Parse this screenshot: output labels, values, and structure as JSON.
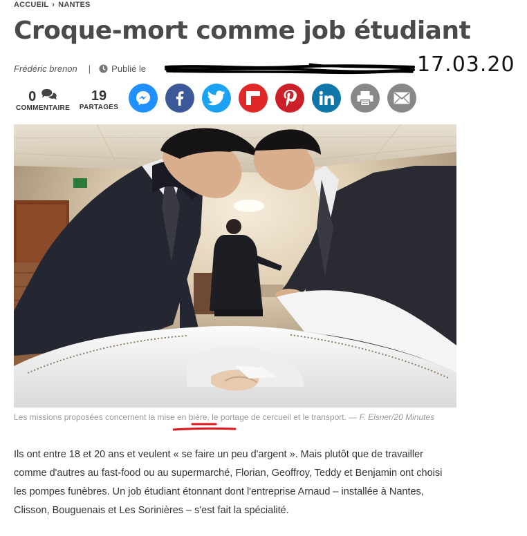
{
  "breadcrumb": {
    "home": "ACCUEIL",
    "separator": "›",
    "section": "NANTES"
  },
  "article": {
    "title": "Croque-mort comme job étudiant",
    "author": "Frédéric brenon",
    "separator": "|",
    "published_label": "Publié le",
    "handwritten_date": "17.03.20",
    "stats": {
      "comments": "0",
      "comments_label": "COMMENTAIRE",
      "shares": "19",
      "shares_label": "PARTAGES"
    },
    "share_buttons": [
      {
        "icon": "messenger-icon",
        "color": "#1e90ff"
      },
      {
        "icon": "facebook-icon",
        "color": "#3b5998"
      },
      {
        "icon": "twitter-icon",
        "color": "#1da1f2"
      },
      {
        "icon": "flipboard-icon",
        "color": "#e12828"
      },
      {
        "icon": "pinterest-icon",
        "color": "#cb2027"
      },
      {
        "icon": "linkedin-icon",
        "color": "#0e76a8"
      },
      {
        "icon": "print-icon",
        "color": "#888888"
      },
      {
        "icon": "email-icon",
        "color": "#888888"
      }
    ],
    "caption": {
      "before": "Les missions proposées concernent la ",
      "highlight": "mise en bière",
      "after": ", le portage de cercueil et le transport. — ",
      "credit": "F. Elsner/20 Minutes"
    },
    "body": "Ils ont entre 18 et 20 ans et veulent « se faire un peu d'argent ». Mais plutôt que de travailler comme d'autres au fast-food ou au supermarché, Florian, Geoffroy, Teddy et Benjamin ont choisi les pompes funèbres. Un job étudiant étonnant dont l'entreprise Arnaud – installée à Nantes, Clisson, Bouguenais et Les Sorinières – s'est fait la spécialité."
  },
  "colors": {
    "title": "#4a4a4a",
    "annotation_red": "#e0141e",
    "caption": "#999999"
  }
}
